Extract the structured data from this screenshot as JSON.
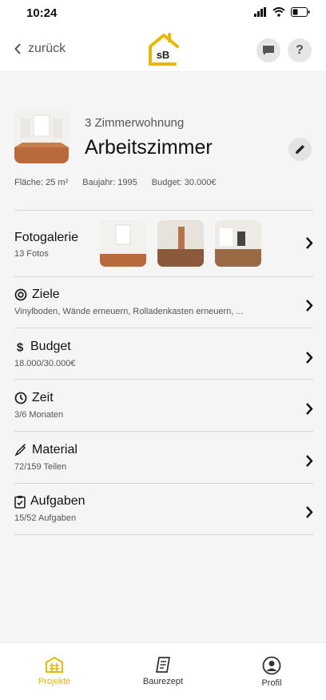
{
  "status": {
    "time": "10:24"
  },
  "header": {
    "back_label": "zurück",
    "logo_text": "sB",
    "help_label": "?"
  },
  "room": {
    "subtitle": "3 Zimmerwohnung",
    "title": "Arbeitszimmer",
    "area": "Fläche: 25 m²",
    "year": "Baujahr: 1995",
    "budget": "Budget: 30.000€"
  },
  "gallery": {
    "title": "Fotogalerie",
    "count": "13 Fotos"
  },
  "rows": [
    {
      "title": "Ziele",
      "sub": "Vinylboden, Wände erneuern, Rolladenkasten erneuern, ..."
    },
    {
      "title": "Budget",
      "sub": "18.000/30.000€"
    },
    {
      "title": "Zeit",
      "sub": "3/6 Monaten"
    },
    {
      "title": "Material",
      "sub": "72/159 Teilen"
    },
    {
      "title": "Aufgaben",
      "sub": "15/52 Aufgaben"
    }
  ],
  "tabs": [
    {
      "label": "Projekte",
      "icon": "projects-icon"
    },
    {
      "label": "Baurezept",
      "icon": "recipe-icon"
    },
    {
      "label": "Profil",
      "icon": "profile-icon"
    }
  ],
  "colors": {
    "accent": "#e6b800",
    "text": "#111111",
    "muted": "#555555",
    "background": "#f5f5f5"
  }
}
